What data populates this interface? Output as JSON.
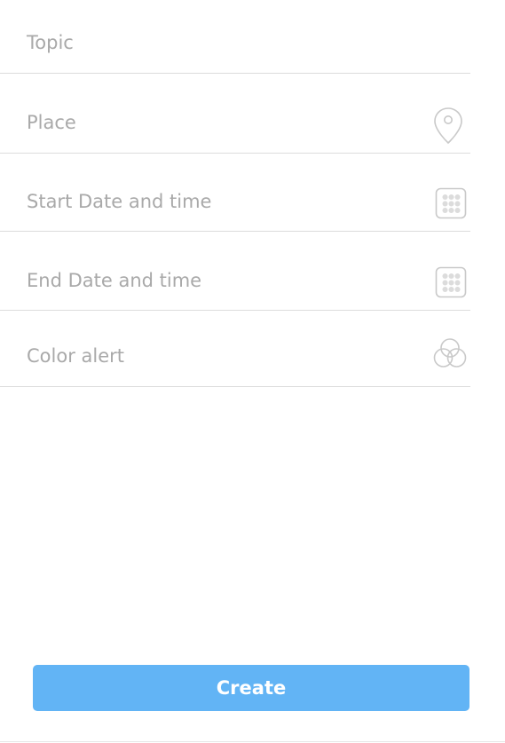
{
  "form": {
    "fields": [
      {
        "label": "Topic",
        "icon": null
      },
      {
        "label": "Place",
        "icon": "location-pin-icon"
      },
      {
        "label": "Start Date and time",
        "icon": "calendar-grid-icon"
      },
      {
        "label": "End Date and time",
        "icon": "calendar-grid-icon"
      },
      {
        "label": "Color alert",
        "icon": "color-circles-icon"
      }
    ]
  },
  "actions": {
    "create_label": "Create"
  },
  "colors": {
    "accent": "#62b4f5",
    "placeholder_text": "#a9a9a9",
    "divider": "#dcdcdc",
    "icon": "#c9c9c9"
  }
}
